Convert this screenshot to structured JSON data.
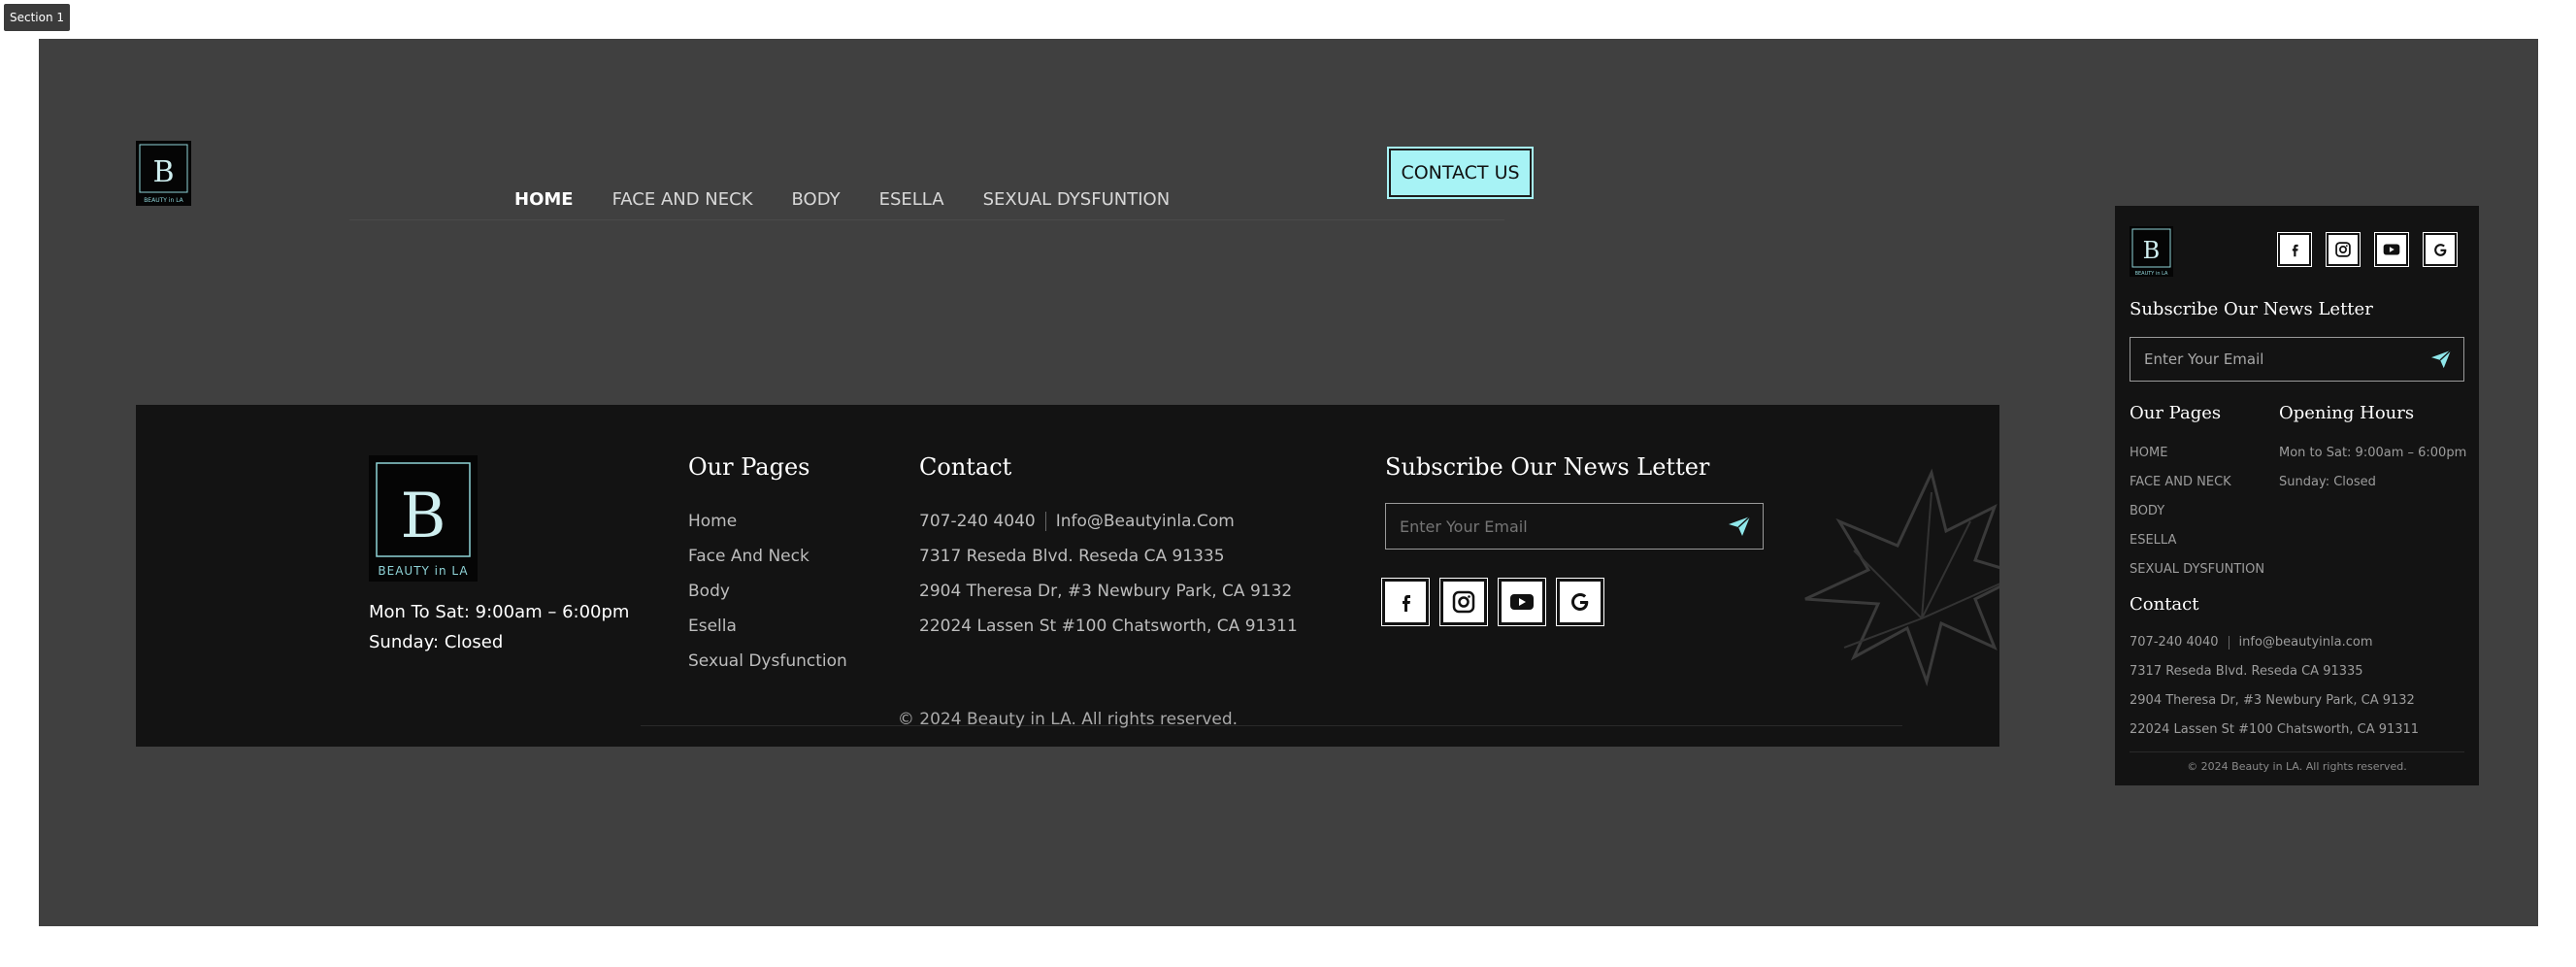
{
  "section_tag": "Section 1",
  "brand": {
    "logo_text": "BEAUTY in LA",
    "logo_letter": "B"
  },
  "nav": {
    "items": [
      "HOME",
      "FACE AND NECK",
      "BODY",
      "ESELLA",
      "SEXUAL DYSFUNTION"
    ],
    "active": "HOME",
    "cta": "CONTACT US"
  },
  "footer": {
    "hours": [
      "Mon To Sat: 9:00am – 6:00pm",
      "Sunday: Closed"
    ],
    "pages_title": "Our Pages",
    "pages": [
      "Home",
      "Face And  Neck",
      "Body",
      "Esella",
      "Sexual Dysfunction"
    ],
    "contact_title": "Contact",
    "phone": "707-240 4040",
    "email": "Info@Beautyinla.Com",
    "addresses": [
      "7317 Reseda Blvd. Reseda CA 91335",
      "2904 Theresa Dr, #3 Newbury Park, CA 9132",
      "22024 Lassen St #100 Chatsworth, CA 91311"
    ],
    "newsletter_title": "Subscribe Our News Letter",
    "newsletter_placeholder": "Enter Your Email",
    "social_icons": [
      "facebook-icon",
      "instagram-icon",
      "youtube-icon",
      "google-icon"
    ],
    "copyright": "© 2024 Beauty in LA. All rights reserved."
  },
  "mobile": {
    "newsletter_title": "Subscribe Our News Letter",
    "newsletter_placeholder": "Enter Your Email",
    "pages_title": "Our Pages",
    "pages": [
      "HOME",
      "FACE AND NECK",
      "BODY",
      "ESELLA",
      "SEXUAL DYSFUNTION"
    ],
    "hours_title": "Opening Hours",
    "hours": [
      "Mon to Sat: 9:00am – 6:00pm",
      "Sunday: Closed"
    ],
    "contact_title": "Contact",
    "phone": "707-240 4040",
    "email": "info@beautyinla.com",
    "addresses": [
      "7317 Reseda Blvd. Reseda CA 91335",
      "2904 Theresa Dr, #3 Newbury Park, CA 9132",
      "22024 Lassen St #100 Chatsworth, CA 91311"
    ],
    "copyright": "© 2024 Beauty in LA. All rights reserved."
  },
  "colors": {
    "accent": "#a7f3f5",
    "canvas": "#404040",
    "footer_bg": "#131313",
    "logo_teal": "#8fd3d7"
  }
}
